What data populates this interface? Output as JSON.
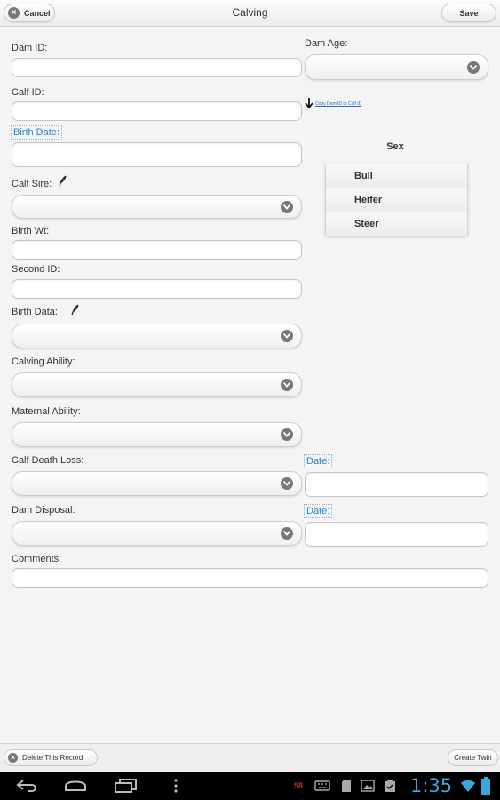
{
  "header": {
    "title": "Calving",
    "cancel_label": "Cancel",
    "save_label": "Save"
  },
  "form": {
    "dam_id": {
      "label": "Dam ID:",
      "value": ""
    },
    "dam_age": {
      "label": "Dam Age:",
      "value": ""
    },
    "calf_id": {
      "label": "Calf ID:",
      "value": ""
    },
    "copy_link": "Copy Dam ID to Calf ID",
    "birth_date": {
      "label": "Birth Date:",
      "value": ""
    },
    "calf_sire": {
      "label": "Calf Sire:",
      "value": ""
    },
    "birth_wt": {
      "label": "Birth Wt:",
      "value": ""
    },
    "second_id": {
      "label": "Second ID:",
      "value": ""
    },
    "birth_data": {
      "label": "Birth Data:",
      "value": ""
    },
    "calving_ability": {
      "label": "Calving Ability:",
      "value": ""
    },
    "maternal_ability": {
      "label": "Maternal Ability:",
      "value": ""
    },
    "calf_death_loss": {
      "label": "Calf Death Loss:",
      "value": "",
      "date_label": "Date:"
    },
    "dam_disposal": {
      "label": "Dam Disposal:",
      "value": "",
      "date_label": "Date:"
    },
    "comments": {
      "label": "Comments:",
      "value": ""
    }
  },
  "sex": {
    "title": "Sex",
    "options": [
      "Bull",
      "Heifer",
      "Steer"
    ]
  },
  "footer": {
    "delete_label": "Delete This Record",
    "twin_label": "Create Twin"
  },
  "system_bar": {
    "time": "1:35",
    "notification_count": "58"
  },
  "colors": {
    "link": "#2a86c8",
    "clock": "#39a7dc",
    "background": "#f4f4f4"
  }
}
